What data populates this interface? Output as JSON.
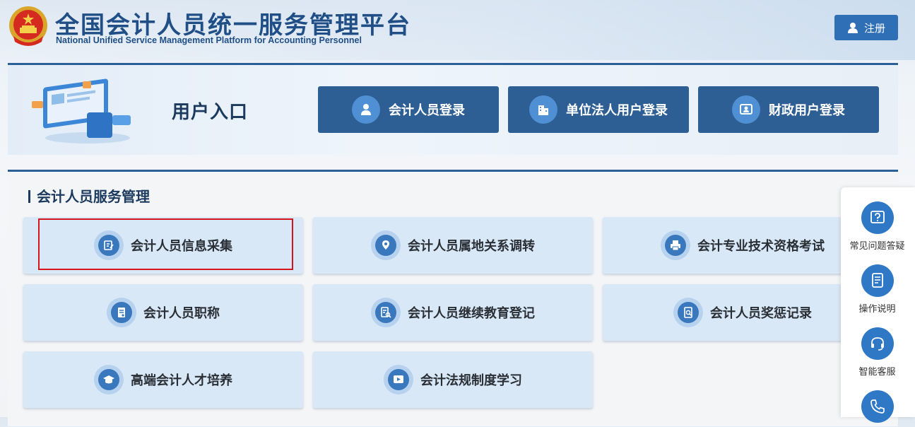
{
  "header": {
    "title_cn": "全国会计人员统一服务管理平台",
    "title_en": "National Unified Service Management Platform for Accounting Personnel",
    "register_label": "注册"
  },
  "user_entry": {
    "title": "用户入口",
    "buttons": [
      {
        "label": "会计人员登录",
        "icon": "person-icon"
      },
      {
        "label": "单位法人用户登录",
        "icon": "building-icon"
      },
      {
        "label": "财政用户登录",
        "icon": "id-card-icon"
      }
    ]
  },
  "services": {
    "section_title": "会计人员服务管理",
    "cards": [
      {
        "label": "会计人员信息采集",
        "icon": "edit-form-icon"
      },
      {
        "label": "会计人员属地关系调转",
        "icon": "location-transfer-icon"
      },
      {
        "label": "会计专业技术资格考试",
        "icon": "exam-print-icon"
      },
      {
        "label": "会计人员职称",
        "icon": "title-document-icon"
      },
      {
        "label": "会计人员继续教育登记",
        "icon": "education-search-icon"
      },
      {
        "label": "会计人员奖惩记录",
        "icon": "record-search-icon"
      },
      {
        "label": "高端会计人才培养",
        "icon": "graduation-cap-icon"
      },
      {
        "label": "会计法规制度学习",
        "icon": "play-video-icon"
      }
    ]
  },
  "side_tools": [
    {
      "label": "常见问题答疑",
      "icon": "question-icon"
    },
    {
      "label": "操作说明",
      "icon": "manual-icon"
    },
    {
      "label": "智能客服",
      "icon": "headset-icon"
    },
    {
      "label": "",
      "icon": "phone-icon"
    }
  ],
  "colors": {
    "primary": "#2e5f94",
    "accent": "#2e78c6",
    "card_bg": "#d9e8f7",
    "highlight": "#d6141b"
  }
}
